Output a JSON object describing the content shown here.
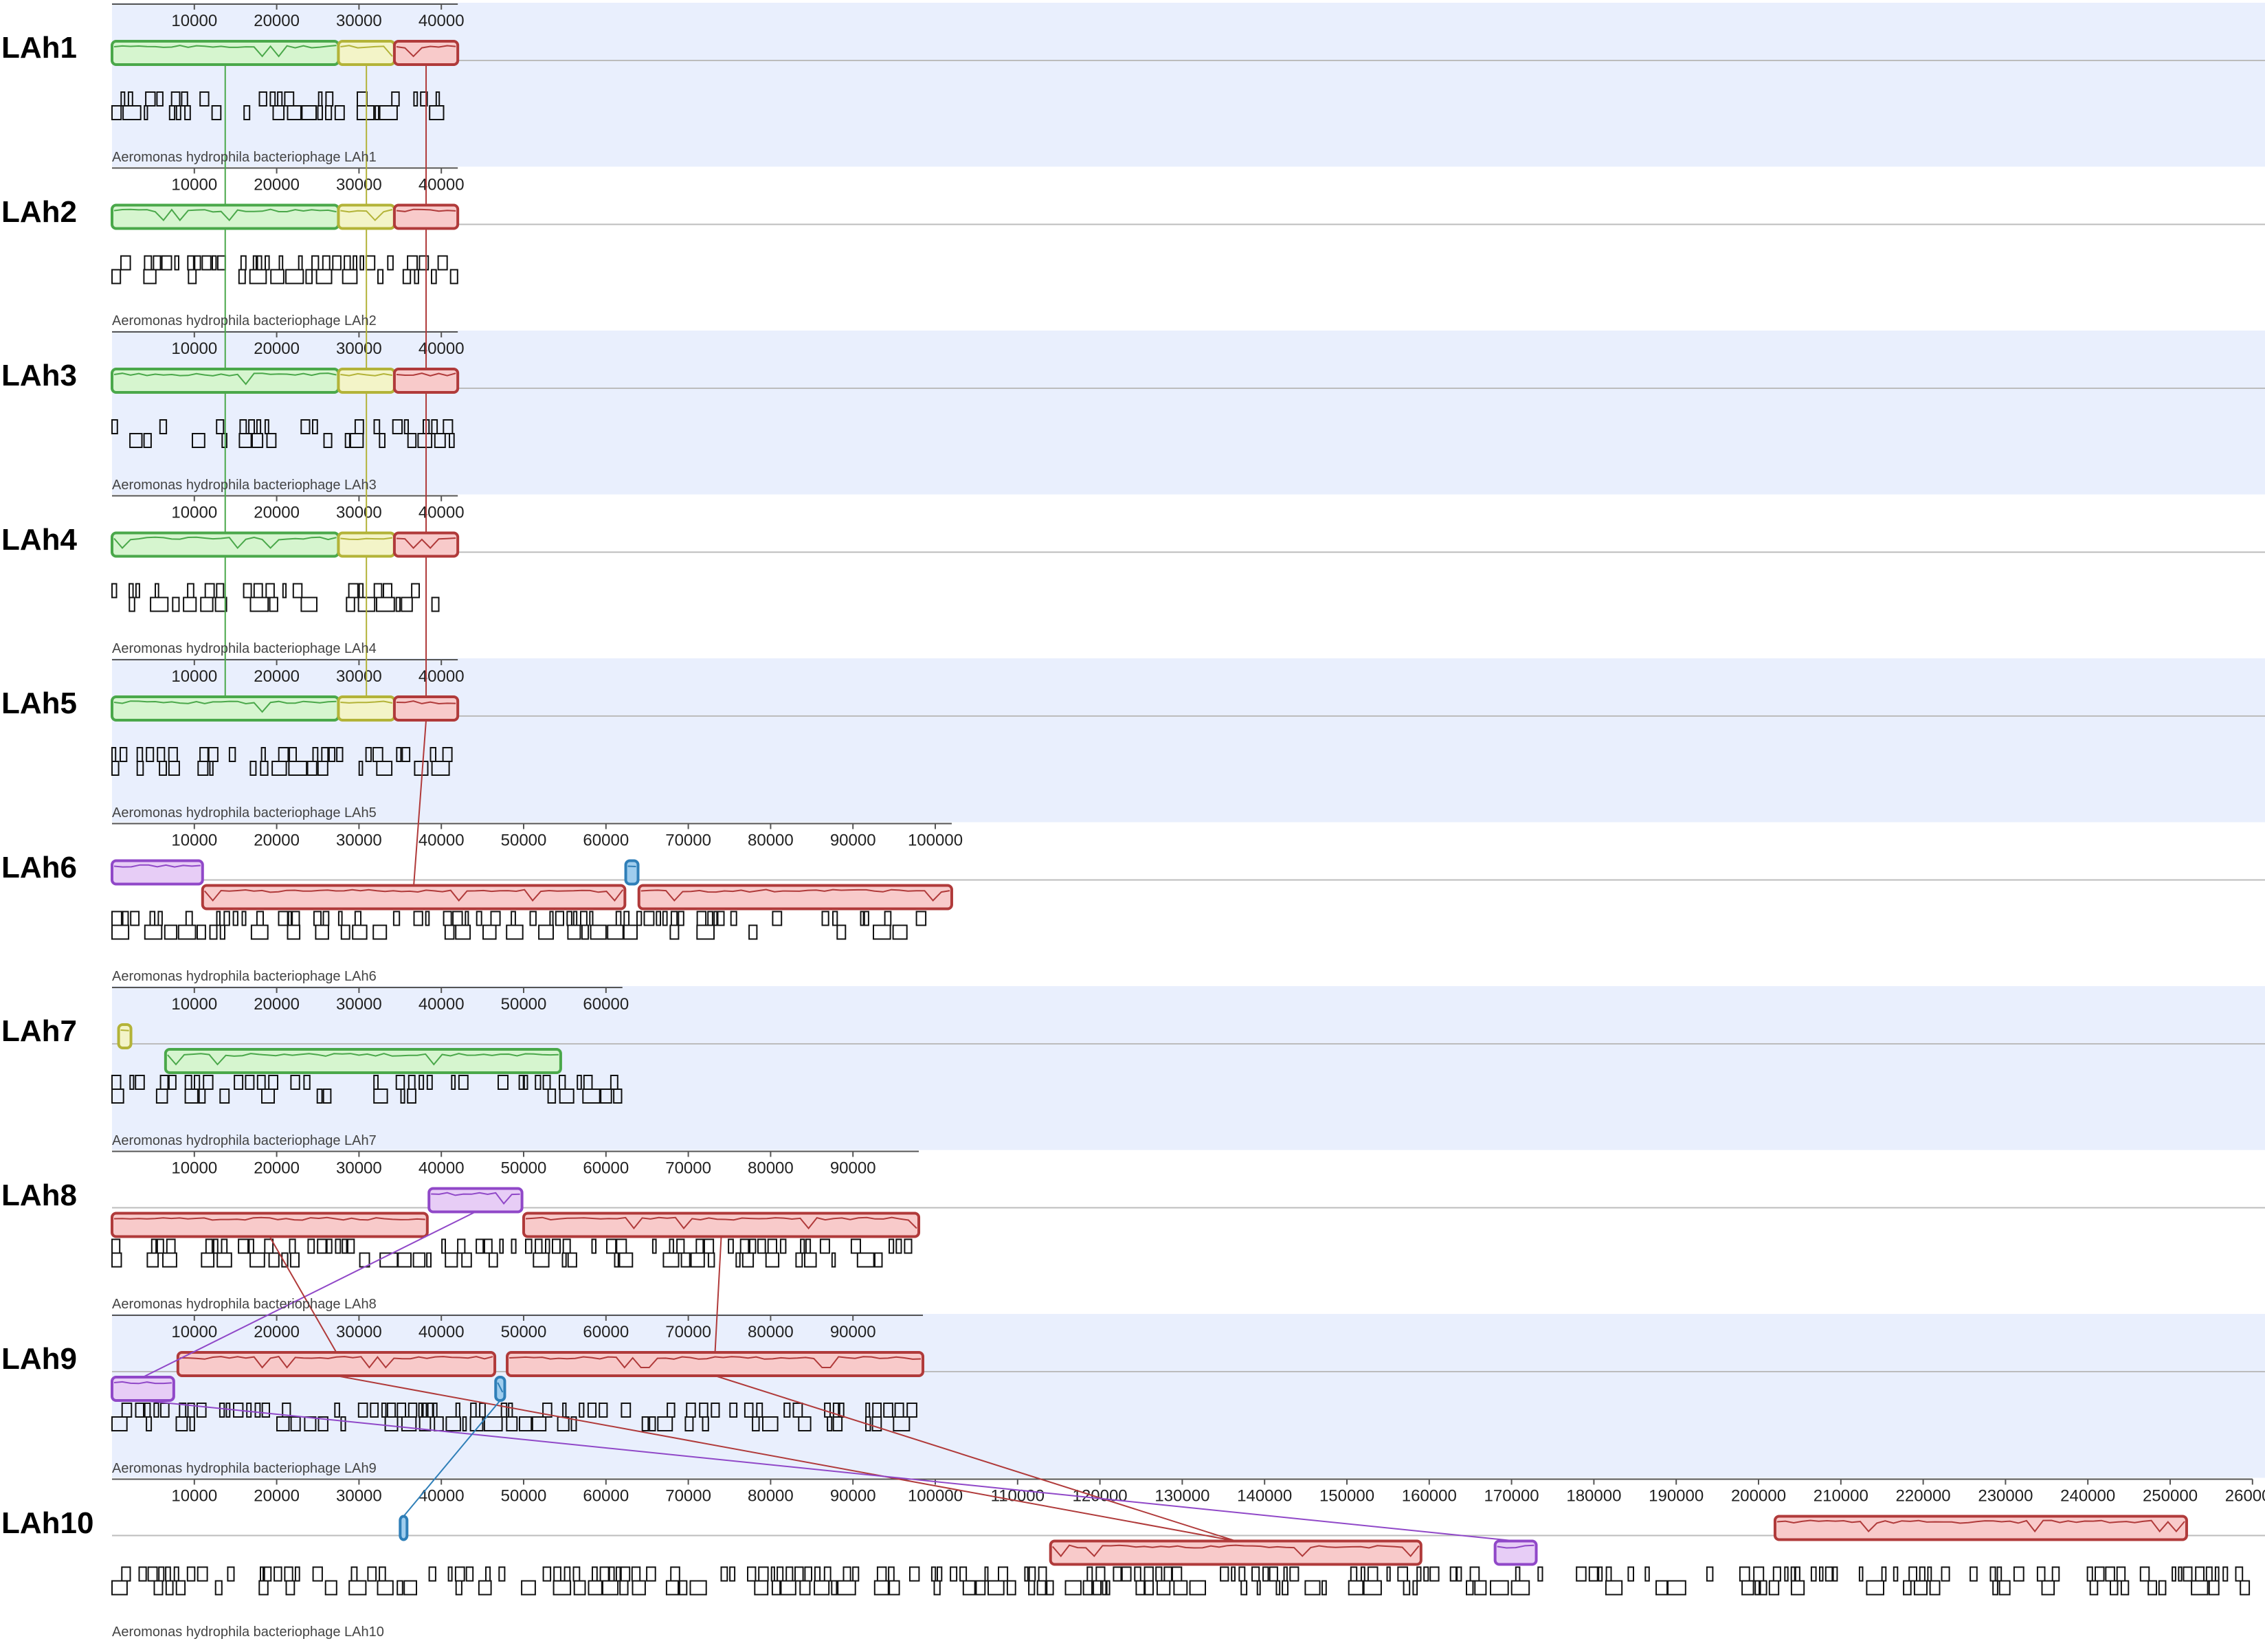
{
  "colors": {
    "band": "#e9effd",
    "green": "#4aa84a",
    "green_fill": "#d6f5cf",
    "yellow": "#b3b338",
    "yellow_fill": "#f3f4c8",
    "red": "#b03a3a",
    "red_fill": "#f8caca",
    "purple": "#9048c8",
    "purple_fill": "#e7cdf6",
    "blue": "#2f7fb8",
    "blue_fill": "#9fcdee"
  },
  "genomes": [
    {
      "label": "LAh1",
      "name": "Aeromonas hydrophila bacteriophage LAh1",
      "length": 42000,
      "ticks": [
        "10000",
        "20000",
        "30000",
        "40000"
      ],
      "blocks": [
        {
          "color": "green",
          "start": 0,
          "end": 27500,
          "pos": "upper"
        },
        {
          "color": "yellow",
          "start": 27500,
          "end": 34300,
          "pos": "upper"
        },
        {
          "color": "red",
          "start": 34300,
          "end": 42000,
          "pos": "upper"
        }
      ]
    },
    {
      "label": "LAh2",
      "name": "Aeromonas hydrophila bacteriophage LAh2",
      "length": 42000,
      "ticks": [
        "10000",
        "20000",
        "30000",
        "40000"
      ],
      "blocks": [
        {
          "color": "green",
          "start": 0,
          "end": 27500,
          "pos": "upper"
        },
        {
          "color": "yellow",
          "start": 27500,
          "end": 34300,
          "pos": "upper"
        },
        {
          "color": "red",
          "start": 34300,
          "end": 42000,
          "pos": "upper"
        }
      ]
    },
    {
      "label": "LAh3",
      "name": "Aeromonas hydrophila bacteriophage LAh3",
      "length": 42000,
      "ticks": [
        "10000",
        "20000",
        "30000",
        "40000"
      ],
      "blocks": [
        {
          "color": "green",
          "start": 0,
          "end": 27500,
          "pos": "upper"
        },
        {
          "color": "yellow",
          "start": 27500,
          "end": 34300,
          "pos": "upper"
        },
        {
          "color": "red",
          "start": 34300,
          "end": 42000,
          "pos": "upper"
        }
      ]
    },
    {
      "label": "LAh4",
      "name": "Aeromonas hydrophila bacteriophage LAh4",
      "length": 42000,
      "ticks": [
        "10000",
        "20000",
        "30000",
        "40000"
      ],
      "blocks": [
        {
          "color": "green",
          "start": 0,
          "end": 27500,
          "pos": "upper"
        },
        {
          "color": "yellow",
          "start": 27500,
          "end": 34300,
          "pos": "upper"
        },
        {
          "color": "red",
          "start": 34300,
          "end": 42000,
          "pos": "upper"
        }
      ]
    },
    {
      "label": "LAh5",
      "name": "Aeromonas hydrophila bacteriophage LAh5",
      "length": 42000,
      "ticks": [
        "10000",
        "20000",
        "30000",
        "40000"
      ],
      "blocks": [
        {
          "color": "green",
          "start": 0,
          "end": 27500,
          "pos": "upper"
        },
        {
          "color": "yellow",
          "start": 27500,
          "end": 34300,
          "pos": "upper"
        },
        {
          "color": "red",
          "start": 34300,
          "end": 42000,
          "pos": "upper"
        }
      ]
    },
    {
      "label": "LAh6",
      "name": "Aeromonas hydrophila bacteriophage LAh6",
      "length": 102000,
      "ticks": [
        "10000",
        "20000",
        "30000",
        "40000",
        "50000",
        "60000",
        "70000",
        "80000",
        "90000",
        "100000"
      ],
      "blocks": [
        {
          "color": "purple",
          "start": 0,
          "end": 11000,
          "pos": "upper"
        },
        {
          "color": "blue",
          "start": 62400,
          "end": 63900,
          "pos": "upper"
        },
        {
          "color": "red",
          "start": 11000,
          "end": 62300,
          "pos": "lower"
        },
        {
          "color": "red",
          "start": 64000,
          "end": 102000,
          "pos": "lower"
        }
      ]
    },
    {
      "label": "LAh7",
      "name": "Aeromonas hydrophila bacteriophage LAh7",
      "length": 62000,
      "ticks": [
        "10000",
        "20000",
        "30000",
        "40000",
        "50000",
        "60000"
      ],
      "blocks": [
        {
          "color": "yellow",
          "start": 800,
          "end": 2300,
          "pos": "upper"
        },
        {
          "color": "green",
          "start": 6500,
          "end": 54500,
          "pos": "lower"
        }
      ]
    },
    {
      "label": "LAh8",
      "name": "Aeromonas hydrophila bacteriophage LAh8",
      "length": 98000,
      "ticks": [
        "10000",
        "20000",
        "30000",
        "40000",
        "50000",
        "60000",
        "70000",
        "80000",
        "90000"
      ],
      "blocks": [
        {
          "color": "purple",
          "start": 38500,
          "end": 49800,
          "pos": "upper"
        },
        {
          "color": "red",
          "start": 0,
          "end": 38300,
          "pos": "lower"
        },
        {
          "color": "red",
          "start": 50000,
          "end": 98000,
          "pos": "lower"
        }
      ]
    },
    {
      "label": "LAh9",
      "name": "Aeromonas hydrophila bacteriophage LAh9",
      "length": 98500,
      "ticks": [
        "10000",
        "20000",
        "30000",
        "40000",
        "50000",
        "60000",
        "70000",
        "80000",
        "90000"
      ],
      "blocks": [
        {
          "color": "red",
          "start": 8000,
          "end": 46500,
          "pos": "upper"
        },
        {
          "color": "red",
          "start": 48000,
          "end": 98500,
          "pos": "upper"
        },
        {
          "color": "purple",
          "start": 0,
          "end": 7500,
          "pos": "lower"
        },
        {
          "color": "blue",
          "start": 46600,
          "end": 47700,
          "pos": "lower"
        }
      ]
    },
    {
      "label": "LAh10",
      "name": "Aeromonas hydrophila bacteriophage LAh10",
      "length": 260000,
      "ticks": [
        "10000",
        "20000",
        "30000",
        "40000",
        "50000",
        "60000",
        "70000",
        "80000",
        "90000",
        "100000",
        "110000",
        "120000",
        "130000",
        "140000",
        "150000",
        "160000",
        "170000",
        "180000",
        "190000",
        "200000",
        "210000",
        "220000",
        "230000",
        "240000",
        "250000",
        "260000"
      ],
      "blocks": [
        {
          "color": "blue",
          "start": 35000,
          "end": 35800,
          "pos": "upper"
        },
        {
          "color": "red",
          "start": 202000,
          "end": 252000,
          "pos": "upper"
        },
        {
          "color": "red",
          "start": 114000,
          "end": 159000,
          "pos": "lower"
        },
        {
          "color": "purple",
          "start": 168000,
          "end": 173000,
          "pos": "lower"
        }
      ]
    }
  ]
}
